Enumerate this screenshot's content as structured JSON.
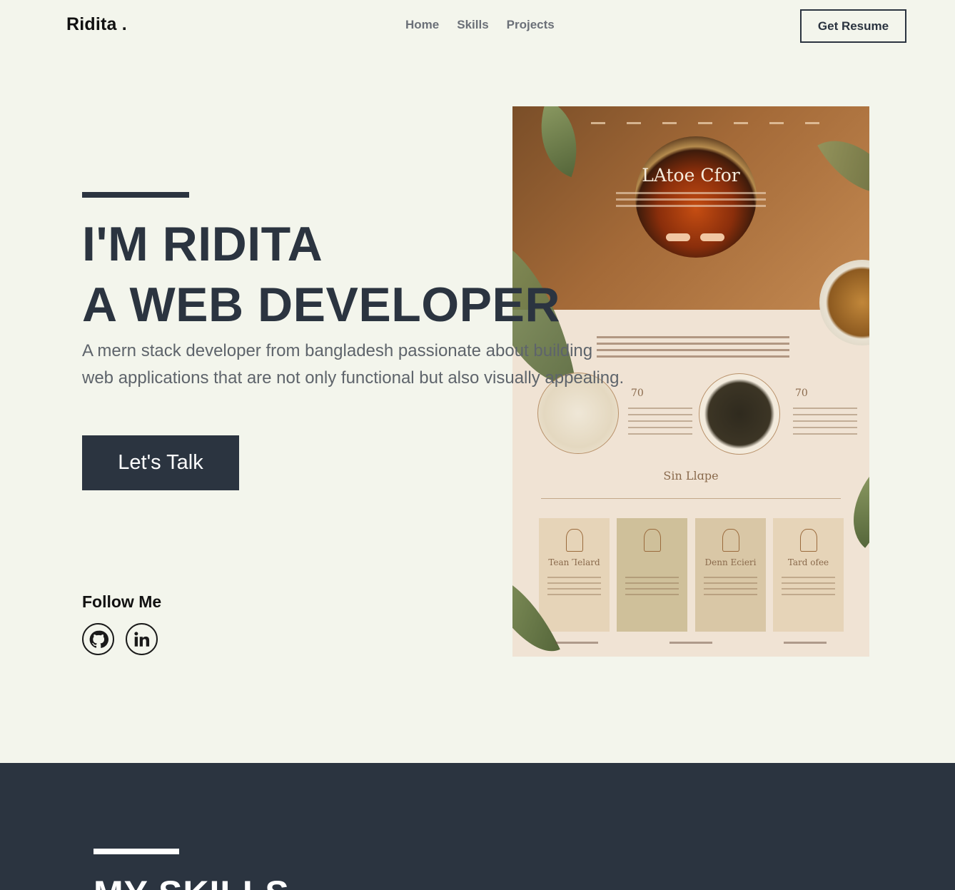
{
  "nav": {
    "logo": "Ridita .",
    "links": [
      "Home",
      "Skills",
      "Projects"
    ],
    "resume_label": "Get Resume"
  },
  "hero": {
    "title_line1": "I'M RIDITA",
    "title_line2": "A WEB DEVELOPER",
    "description": "A mern stack developer from bangladesh passionate about building web applications that are not only functional but also visually appealing.",
    "cta_label": "Let's Talk",
    "follow_label": "Follow Me",
    "social_icons": [
      "github-icon",
      "linkedin-icon"
    ]
  },
  "mockup": {
    "heading": "LAtoe Cfor",
    "number_left": "70",
    "number_right": "70",
    "section_title": "Sin Llɑpe",
    "cards": [
      "Tean Ꞁelard",
      "",
      "Denn Ecieri",
      "Tard ofee"
    ]
  },
  "skills": {
    "title": "MY SKILLS"
  },
  "colors": {
    "background": "#f3f5ec",
    "dark": "#2b3440",
    "muted_text": "#5e646b"
  }
}
